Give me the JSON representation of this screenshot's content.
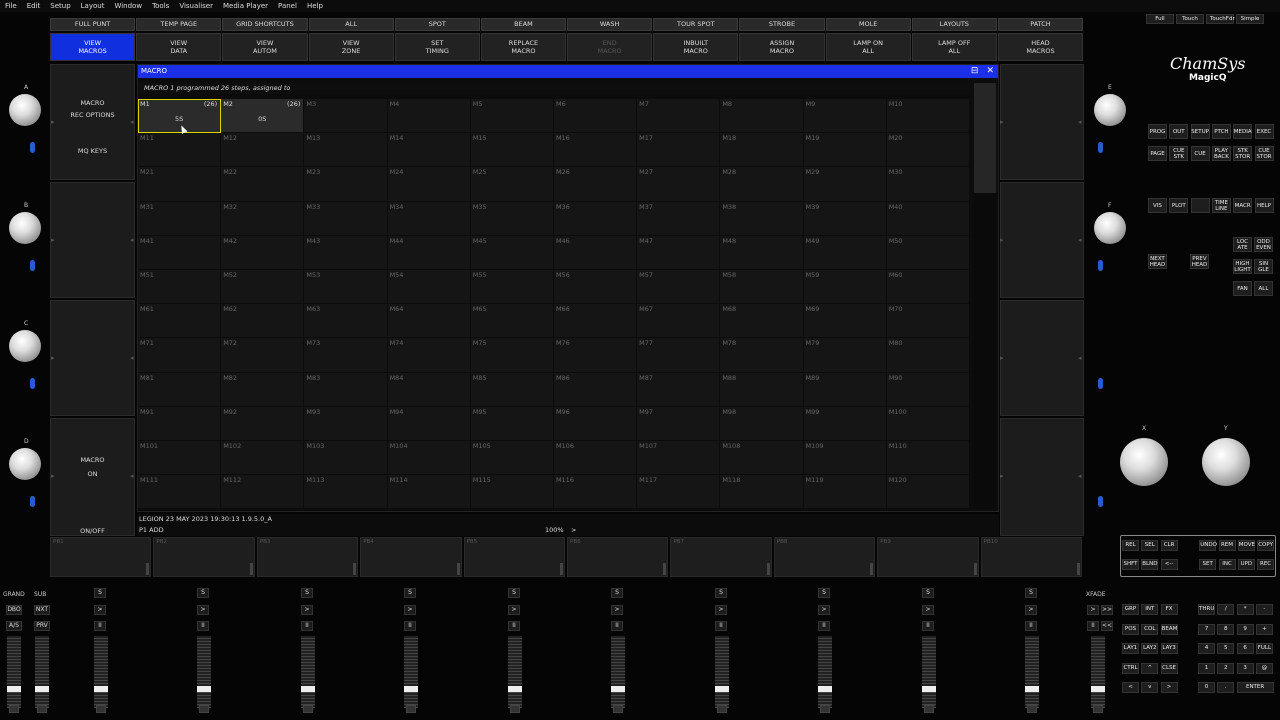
{
  "menubar": [
    "File",
    "Edit",
    "Setup",
    "Layout",
    "Window",
    "Tools",
    "Visualiser",
    "Media Player",
    "Panel",
    "Help"
  ],
  "view_modes": [
    "Full",
    "Touch",
    "TouchFdr",
    "Simple"
  ],
  "top_windows": [
    "FULL PUNT",
    "TEMP PAGE",
    "GRID SHORTCUTS",
    "ALL",
    "SPOT",
    "BEAM",
    "WASH",
    "TOUR SPOT",
    "STROBE",
    "MOLE",
    "LAYOUTS",
    "PATCH"
  ],
  "softkeys": [
    {
      "label": "VIEW\nMACROS",
      "state": "active"
    },
    {
      "label": "VIEW\nDATA",
      "state": "normal"
    },
    {
      "label": "VIEW\nAUTOM",
      "state": "normal"
    },
    {
      "label": "VIEW\nZONE",
      "state": "normal"
    },
    {
      "label": "SET\nTIMING",
      "state": "normal"
    },
    {
      "label": "REPLACE\nMACRO",
      "state": "normal"
    },
    {
      "label": "END\nMACRO",
      "state": "dim"
    },
    {
      "label": "INBUILT\nMACRO",
      "state": "normal"
    },
    {
      "label": "ASSIGN\nMACRO",
      "state": "normal"
    },
    {
      "label": "LAMP ON\nALL",
      "state": "normal"
    },
    {
      "label": "LAMP OFF\nALL",
      "state": "normal"
    },
    {
      "label": "HEAD\nMACROS",
      "state": "normal"
    }
  ],
  "left_panel": {
    "btn1": "MACRO\nREC OPTIONS",
    "btn2": "MQ KEYS",
    "btn3": "MACRO\nON",
    "btn4": "ON/OFF"
  },
  "encoders_left": [
    "A",
    "B",
    "C",
    "D"
  ],
  "encoders_right": [
    "E",
    "F"
  ],
  "encoders_xy": [
    "X",
    "Y"
  ],
  "macro_window": {
    "title": "MACRO",
    "status": "MACRO 1 programmed 26 steps, assigned to",
    "cells": [
      {
        "id": "M1",
        "steps": "(26)",
        "value": "5S",
        "selected": true
      },
      {
        "id": "M2",
        "steps": "(26)",
        "value": "0S",
        "selected": false
      }
    ],
    "total": 120
  },
  "status_line": {
    "version": "LEGION 23 MAY 2023 19:30:13 1.9.5.0_A",
    "cmd": "P1  ADD",
    "zoom": "100%",
    "prompt": ">"
  },
  "playbacks": [
    "PB1",
    "PB2",
    "PB3",
    "PB4",
    "PB5",
    "PB6",
    "PB7",
    "PB8",
    "PB9",
    "PB10"
  ],
  "fader_labels": {
    "grand": "GRAND",
    "sub": "SUB",
    "xfade": "XFADE"
  },
  "fader_buttons": {
    "s": "S",
    "go": ">",
    "pause": "II",
    "dbo": "DBO",
    "nxt": "NXT",
    "as": "A/S",
    "prv": "PRV",
    "ff": ">>",
    "rew": "<<"
  },
  "logo": {
    "line1": "ChamSys",
    "line2": "MagicQ"
  },
  "right_buttons": {
    "row1": [
      "PROG",
      "OUT",
      "SETUP",
      "PTCH",
      "MEDIA",
      "EXEC"
    ],
    "row2": [
      "PAGE",
      "CUE\nSTK",
      "CUE",
      "PLAY\nBACK",
      "STK\nSTOR",
      "CUE\nSTOR"
    ],
    "row3": [
      "VIS",
      "PLOT",
      "",
      "TIME\nLINE",
      "MACR",
      "HELP"
    ],
    "head1": "NEXT\nHEAD",
    "head2": "PREV\nHEAD",
    "locate": [
      "LOC\nATE",
      "ODD\nEVEN"
    ],
    "highlight": [
      "HIGH\nLIGHT",
      "SIN\nGLE"
    ],
    "fan": [
      "FAN",
      "ALL"
    ]
  },
  "keypad_rows": [
    [
      "REL",
      "SEL",
      "CLR",
      "",
      "UNDO",
      "REM",
      "MOVE",
      "COPY"
    ],
    [
      "SHFT",
      "BLND",
      "<--",
      "",
      "SET",
      "INC",
      "UPD",
      "REC"
    ]
  ],
  "lower_keys": {
    "left": [
      [
        "GRP",
        "INT",
        "FX"
      ],
      [
        "POS",
        "COL",
        "BEAM"
      ],
      [
        "LAY1",
        "LAY2",
        "LAY3"
      ],
      [
        "CTRL",
        "^",
        "CLSE"
      ],
      [
        "<",
        "v",
        ">"
      ]
    ],
    "right": [
      [
        "THRU",
        "/",
        "*",
        "-"
      ],
      [
        "7",
        "8",
        "9",
        "+"
      ],
      [
        "4",
        "5",
        "6",
        "FULL"
      ],
      [
        "1",
        "2",
        "3",
        "@"
      ],
      [
        "0",
        ".",
        "ENTER"
      ]
    ]
  }
}
